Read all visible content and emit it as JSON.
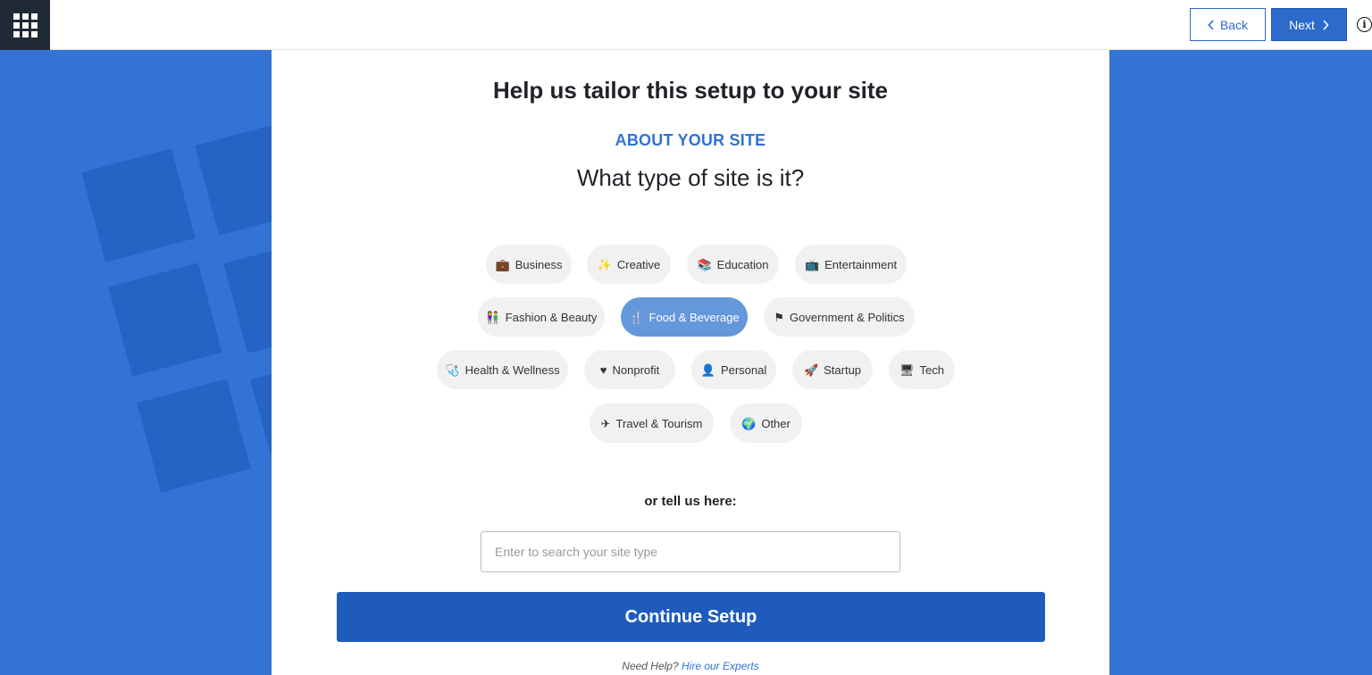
{
  "topbar": {
    "menu_icon": "grid-icon",
    "back_label": "Back",
    "next_label": "Next",
    "info_icon": "info-icon"
  },
  "main": {
    "title": "Help us tailor this setup to your site",
    "eyebrow": "ABOUT YOUR SITE",
    "question": "What type of site is it?",
    "site_types": [
      {
        "label": "Business",
        "icon": "briefcase-icon",
        "selected": false
      },
      {
        "label": "Creative",
        "icon": "magic-wand-icon",
        "selected": false
      },
      {
        "label": "Education",
        "icon": "books-icon",
        "selected": false
      },
      {
        "label": "Entertainment",
        "icon": "tv-icon",
        "selected": false
      },
      {
        "label": "Fashion & Beauty",
        "icon": "people-icon",
        "selected": false
      },
      {
        "label": "Food & Beverage",
        "icon": "utensils-icon",
        "selected": true
      },
      {
        "label": "Government & Politics",
        "icon": "flag-icon",
        "selected": false
      },
      {
        "label": "Health & Wellness",
        "icon": "medkit-icon",
        "selected": false
      },
      {
        "label": "Nonprofit",
        "icon": "heart-icon",
        "selected": false
      },
      {
        "label": "Personal",
        "icon": "user-icon",
        "selected": false
      },
      {
        "label": "Startup",
        "icon": "rocket-icon",
        "selected": false
      },
      {
        "label": "Tech",
        "icon": "monitor-icon",
        "selected": false
      },
      {
        "label": "Travel & Tourism",
        "icon": "plane-icon",
        "selected": false
      },
      {
        "label": "Other",
        "icon": "globe-icon",
        "selected": false
      }
    ],
    "tell_label": "or tell us here:",
    "search_placeholder": "Enter to search your site type",
    "search_value": "",
    "continue_label": "Continue Setup",
    "help_prefix": "Need Help?",
    "help_link": "Hire our Experts"
  },
  "colors": {
    "accent": "#2c6bcb",
    "background": "#3473d6",
    "chip_selected": "#6497dc",
    "chip": "#f1f1f1"
  }
}
